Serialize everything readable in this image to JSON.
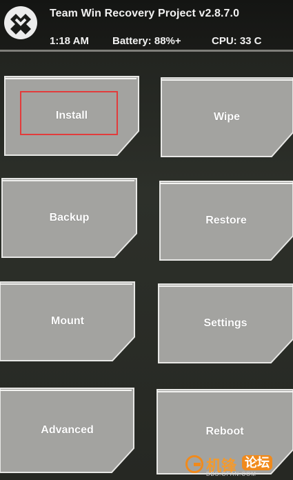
{
  "header": {
    "title": "Team Win Recovery Project  v2.8.7.0",
    "time": "1:18 AM",
    "battery": "Battery: 88%+",
    "cpu": "CPU: 33 C"
  },
  "tiles": [
    {
      "label": "Install"
    },
    {
      "label": "Wipe"
    },
    {
      "label": "Backup"
    },
    {
      "label": "Restore"
    },
    {
      "label": "Mount"
    },
    {
      "label": "Settings"
    },
    {
      "label": "Advanced"
    },
    {
      "label": "Reboot"
    }
  ],
  "highlighted_tile": "Install",
  "colors": {
    "tile_fill": "#a3a3a0",
    "tile_edge": "#e8e8e6",
    "highlight": "#e23b3b",
    "header_bg": "#161715",
    "watermark_orange": "#f08a1c"
  },
  "watermark": {
    "text_primary": "机锋",
    "text_secondary": "论坛",
    "url": "BBS.GFAN.COM"
  }
}
